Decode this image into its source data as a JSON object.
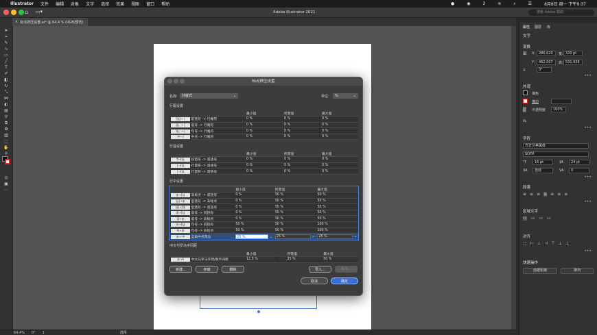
{
  "menubar": {
    "apple": "",
    "app": "Illustrator",
    "items": [
      "文件",
      "编辑",
      "对象",
      "文字",
      "选择",
      "效果",
      "视图",
      "窗口",
      "帮助"
    ],
    "datetime": "8月8日 周一 下午9:37",
    "battery": "2"
  },
  "titlebar": {
    "title": "Adobe Illustrator 2021",
    "search_placeholder": "搜索 Adobe 帮助"
  },
  "document": {
    "tab": "标点挤压设置.ai* @ 64.4 % (RGB/预览)",
    "zoom": "64.4%",
    "rotation": "0°",
    "page": "1",
    "tool": "选择"
  },
  "panel": {
    "tabs": [
      "属性",
      "图层",
      "库"
    ],
    "type_label": "文字",
    "transform": {
      "title": "变换",
      "x_label": "X:",
      "x": "286.620",
      "y_label": "Y:",
      "y": "462.007",
      "w_label": "宽:",
      "w": "320 pt",
      "h_label": "高:",
      "h": "531.938",
      "angle": "0°"
    },
    "appearance": {
      "title": "外观",
      "fill": "填色",
      "stroke": "描边",
      "opacity_label": "不透明度",
      "opacity": "100%",
      "fx": "fx."
    },
    "character": {
      "title": "字符",
      "font": "方正兰亭黑体",
      "style": "SOFR",
      "size": "16 pt",
      "leading": "24 pt",
      "tracking": "自动",
      "kerning": "0"
    },
    "paragraph": {
      "title": "段落"
    },
    "area_type": {
      "title": "区域文字"
    },
    "align": {
      "title": "对齐"
    },
    "quick_actions": {
      "title": "快速操作",
      "outline": "创建轮廓",
      "arrange": "排列"
    }
  },
  "dialog": {
    "title": "标点挤压设置",
    "name_label": "名称:",
    "name_value": "外嵌式",
    "unit_label": "单位:",
    "unit_value": "%",
    "cols": {
      "min": "最小值",
      "desired": "所需值",
      "max": "最大值"
    },
    "sections": [
      {
        "title": "行尾设置",
        "rows": [
          {
            "icon": "[括]→│",
            "label": "前括号 -> 行尾符",
            "min": "0 %",
            "desired": "0 %",
            "max": "0 %"
          },
          {
            "icon": "逗。→│",
            "label": "逗号 -> 行尾符",
            "min": "0 %",
            "desired": "0 %",
            "max": "0 %"
          },
          {
            "icon": "句。→│",
            "label": "句号 -> 行尾符",
            "min": "0 %",
            "desired": "0 %",
            "max": "0 %"
          },
          {
            "icon": "·中→│",
            "label": "中点 -> 行尾符",
            "min": "0 %",
            "desired": "0 %",
            "max": "0 %"
          }
        ]
      },
      {
        "title": "行首设置",
        "rows": [
          {
            "icon": "¶→[括",
            "label": "段首符 -> 前括号",
            "min": "0 %",
            "desired": "0 %",
            "max": "0 %"
          },
          {
            "icon": "│→[括",
            "label": "行首符 -> 前括号",
            "min": "0 %",
            "desired": "0 %",
            "max": "0 %"
          },
          {
            "icon": "│→[括",
            "label": "行首符 -> 前括号",
            "min": "0 %",
            "desired": "0 %",
            "max": "0 %"
          }
        ]
      },
      {
        "title": "行中设置",
        "rows": [
          {
            "icon": "あ→[括",
            "label": "非标点 -> 前括号",
            "min": "0 %",
            "desired": "50 %",
            "max": "50 %"
          },
          {
            "icon": "括]→あ",
            "label": "后括号 -> 非标点",
            "min": "0 %",
            "desired": "50 %",
            "max": "50 %"
          },
          {
            "icon": "括]→[括",
            "label": "后括号 -> 前括号",
            "min": "0 %",
            "desired": "50 %",
            "max": "50 %"
          },
          {
            "icon": "逗→[括",
            "label": "逗号 -> 前括号",
            "min": "0 %",
            "desired": "50 %",
            "max": "50 %"
          },
          {
            "icon": "逗→あ",
            "label": "逗号 -> 非标点",
            "min": "0 %",
            "desired": "50 %",
            "max": "50 %"
          },
          {
            "icon": "句→[括",
            "label": "句号 -> 前括号",
            "min": "50 %",
            "desired": "50 %",
            "max": "100 %"
          },
          {
            "icon": "句→あ",
            "label": "句号 -> 非标点",
            "min": "50 %",
            "desired": "50 %",
            "max": "100 %"
          },
          {
            "icon": "あ→·中",
            "label": "全角中点周边",
            "min": "25 %",
            "desired": "25 %",
            "max": "25 %",
            "selected": true
          }
        ]
      },
      {
        "title": "中文与罗马字间距",
        "rows": [
          {
            "icon": "あ→A",
            "label": "中文与罗马字母/数字间距",
            "min": "12.5 %",
            "desired": "25 %",
            "max": "50 %"
          }
        ]
      }
    ],
    "buttons": {
      "new": "新建...",
      "save": "存储",
      "delete": "删除",
      "import": "导入...",
      "export": "导出...",
      "cancel": "取消",
      "ok": "确定"
    }
  }
}
